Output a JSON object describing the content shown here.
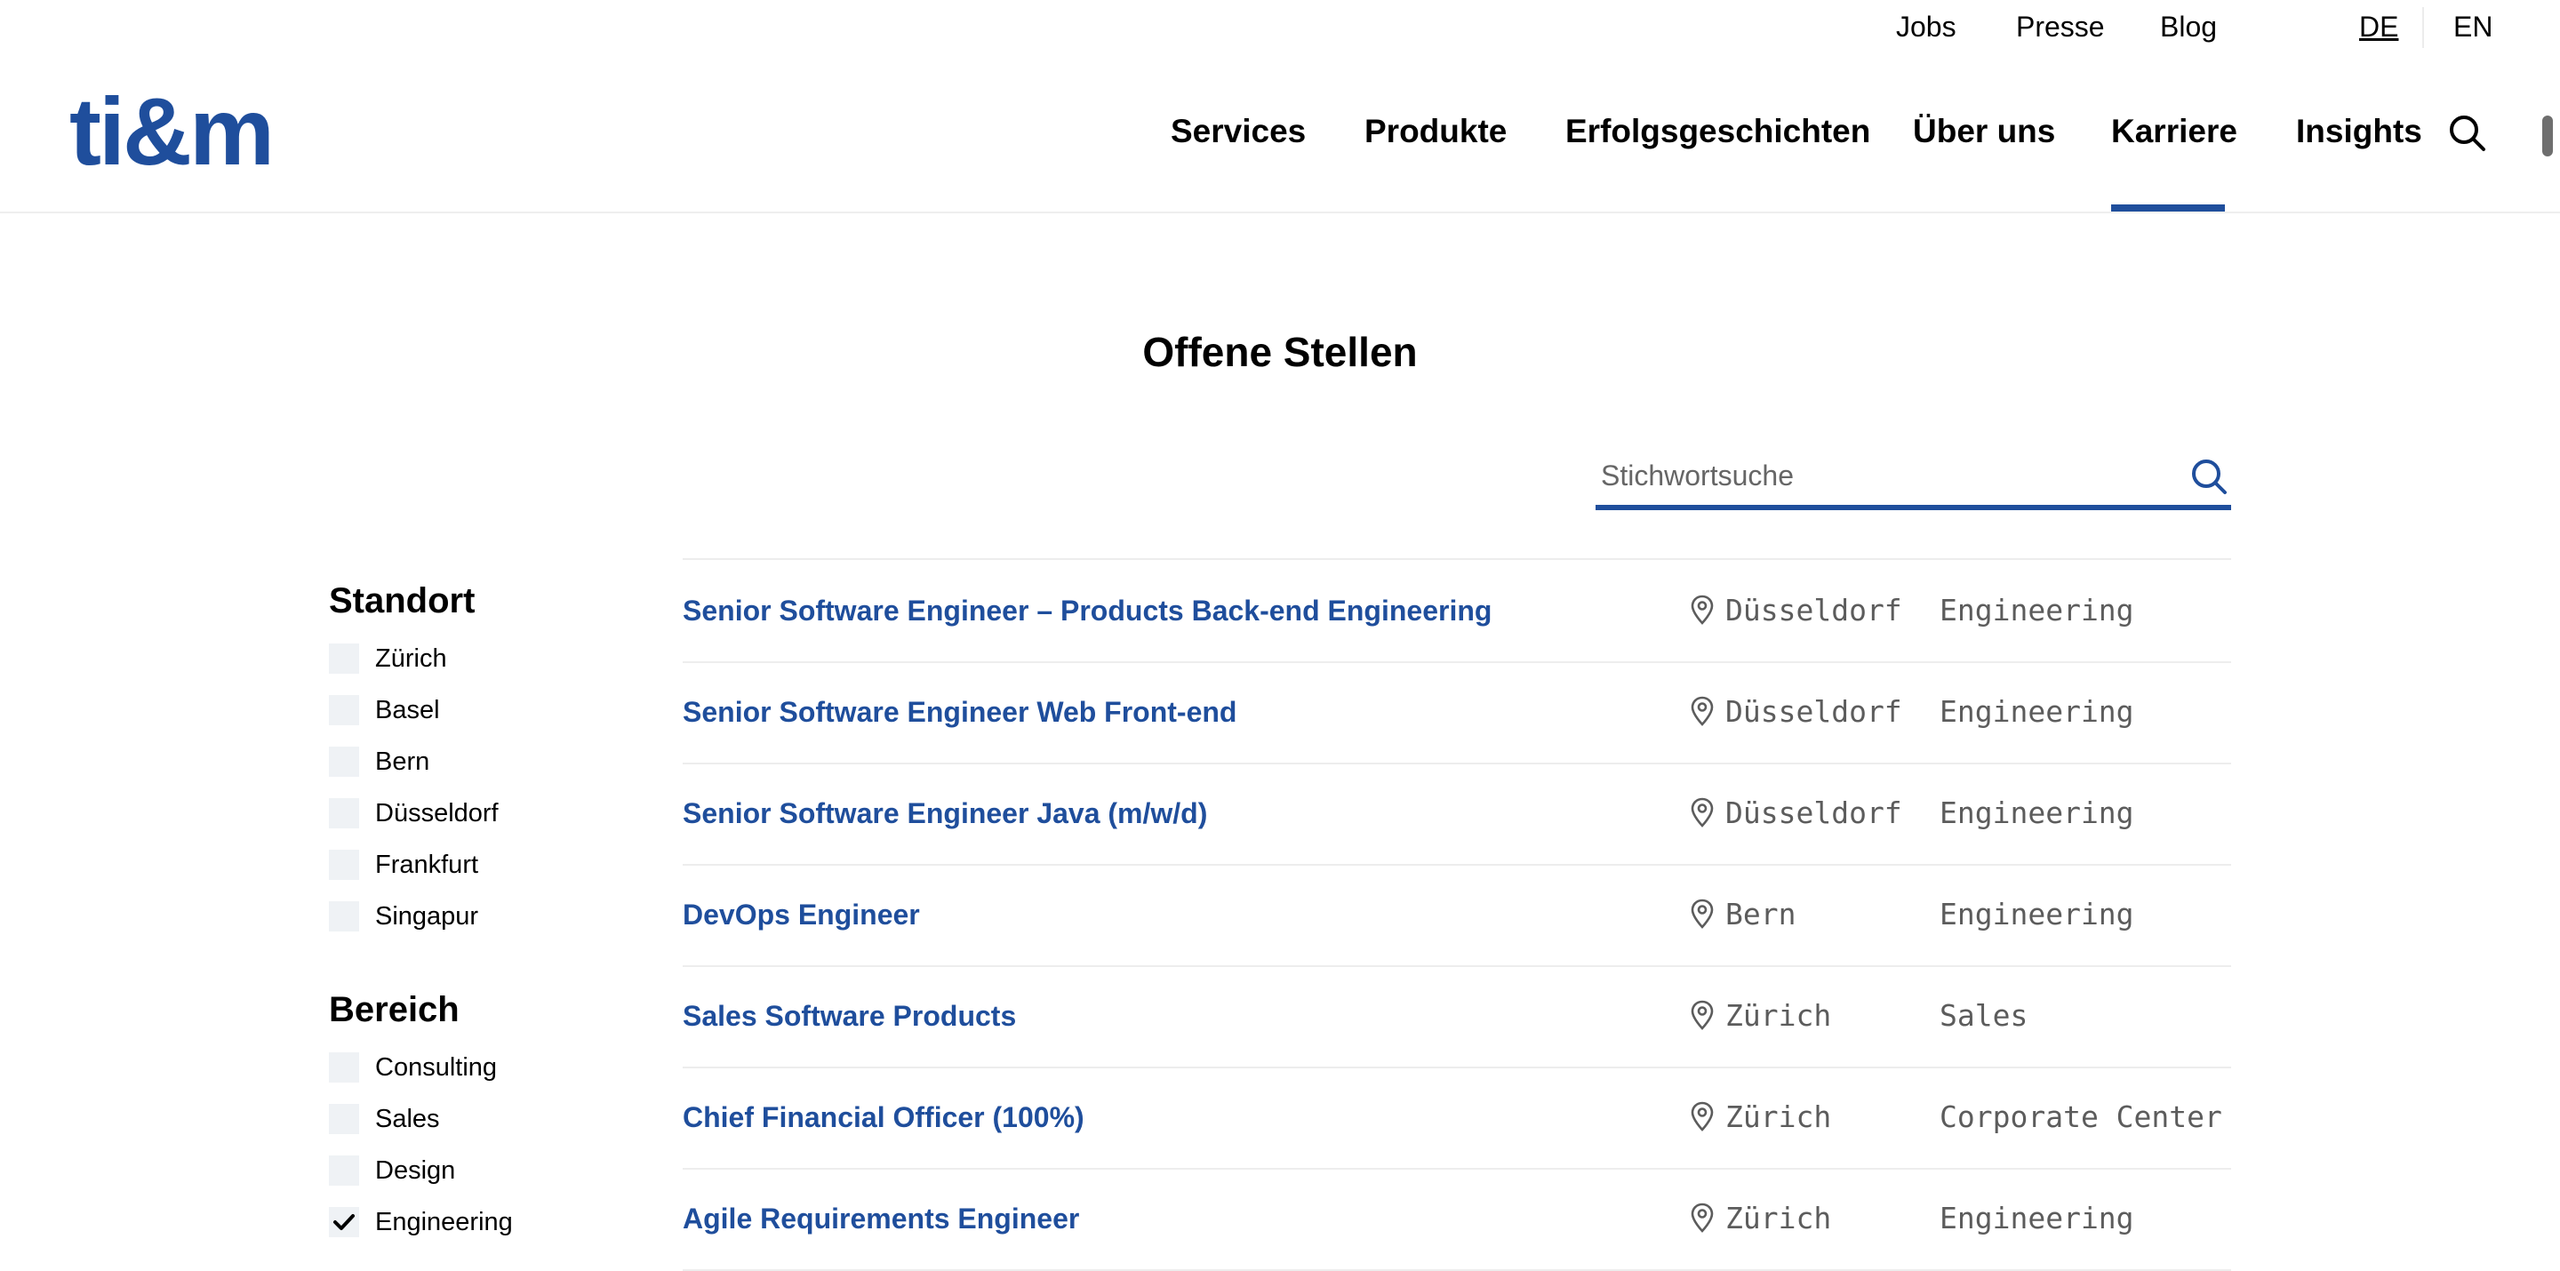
{
  "header": {
    "utility_links": {
      "jobs": "Jobs",
      "presse": "Presse",
      "blog": "Blog"
    },
    "languages": {
      "active": "DE",
      "other": "EN"
    },
    "logo": "ti&m",
    "nav": {
      "services": "Services",
      "produkte": "Produkte",
      "erfolgsgeschichten": "Erfolgsgeschichten",
      "ueber_uns": "Über uns",
      "karriere": "Karriere",
      "insights": "Insights"
    },
    "active_nav": "Karriere",
    "search_icon": "search-icon"
  },
  "colors": {
    "brand": "#1f4e9c",
    "checkbox_bg": "#eff2f5",
    "muted_text": "#5c5c5c"
  },
  "main": {
    "title": "Offene Stellen",
    "search": {
      "placeholder": "Stichwortsuche",
      "value": "",
      "icon": "search-icon"
    }
  },
  "filters": {
    "standort": {
      "heading": "Standort",
      "options": [
        {
          "label": "Zürich",
          "checked": false
        },
        {
          "label": "Basel",
          "checked": false
        },
        {
          "label": "Bern",
          "checked": false
        },
        {
          "label": "Düsseldorf",
          "checked": false
        },
        {
          "label": "Frankfurt",
          "checked": false
        },
        {
          "label": "Singapur",
          "checked": false
        }
      ]
    },
    "bereich": {
      "heading": "Bereich",
      "options": [
        {
          "label": "Consulting",
          "checked": false
        },
        {
          "label": "Sales",
          "checked": false
        },
        {
          "label": "Design",
          "checked": false
        },
        {
          "label": "Engineering",
          "checked": true
        }
      ]
    }
  },
  "jobs": [
    {
      "title": "Senior Software Engineer – Products Back-end Engineering",
      "location": "Düsseldorf",
      "area": "Engineering",
      "icon": "map-pin-icon"
    },
    {
      "title": "Senior Software Engineer Web Front-end",
      "location": "Düsseldorf",
      "area": "Engineering",
      "icon": "map-pin-icon"
    },
    {
      "title": "Senior Software Engineer Java (m/w/d)",
      "location": "Düsseldorf",
      "area": "Engineering",
      "icon": "map-pin-icon"
    },
    {
      "title": "DevOps Engineer",
      "location": "Bern",
      "area": "Engineering",
      "icon": "map-pin-icon"
    },
    {
      "title": "Sales Software Products",
      "location": "Zürich",
      "area": "Sales",
      "icon": "map-pin-icon"
    },
    {
      "title": "Chief Financial Officer (100%)",
      "location": "Zürich",
      "area": "Corporate Center",
      "icon": "map-pin-icon"
    },
    {
      "title": "Agile Requirements Engineer",
      "location": "Zürich",
      "area": "Engineering",
      "icon": "map-pin-icon"
    }
  ]
}
